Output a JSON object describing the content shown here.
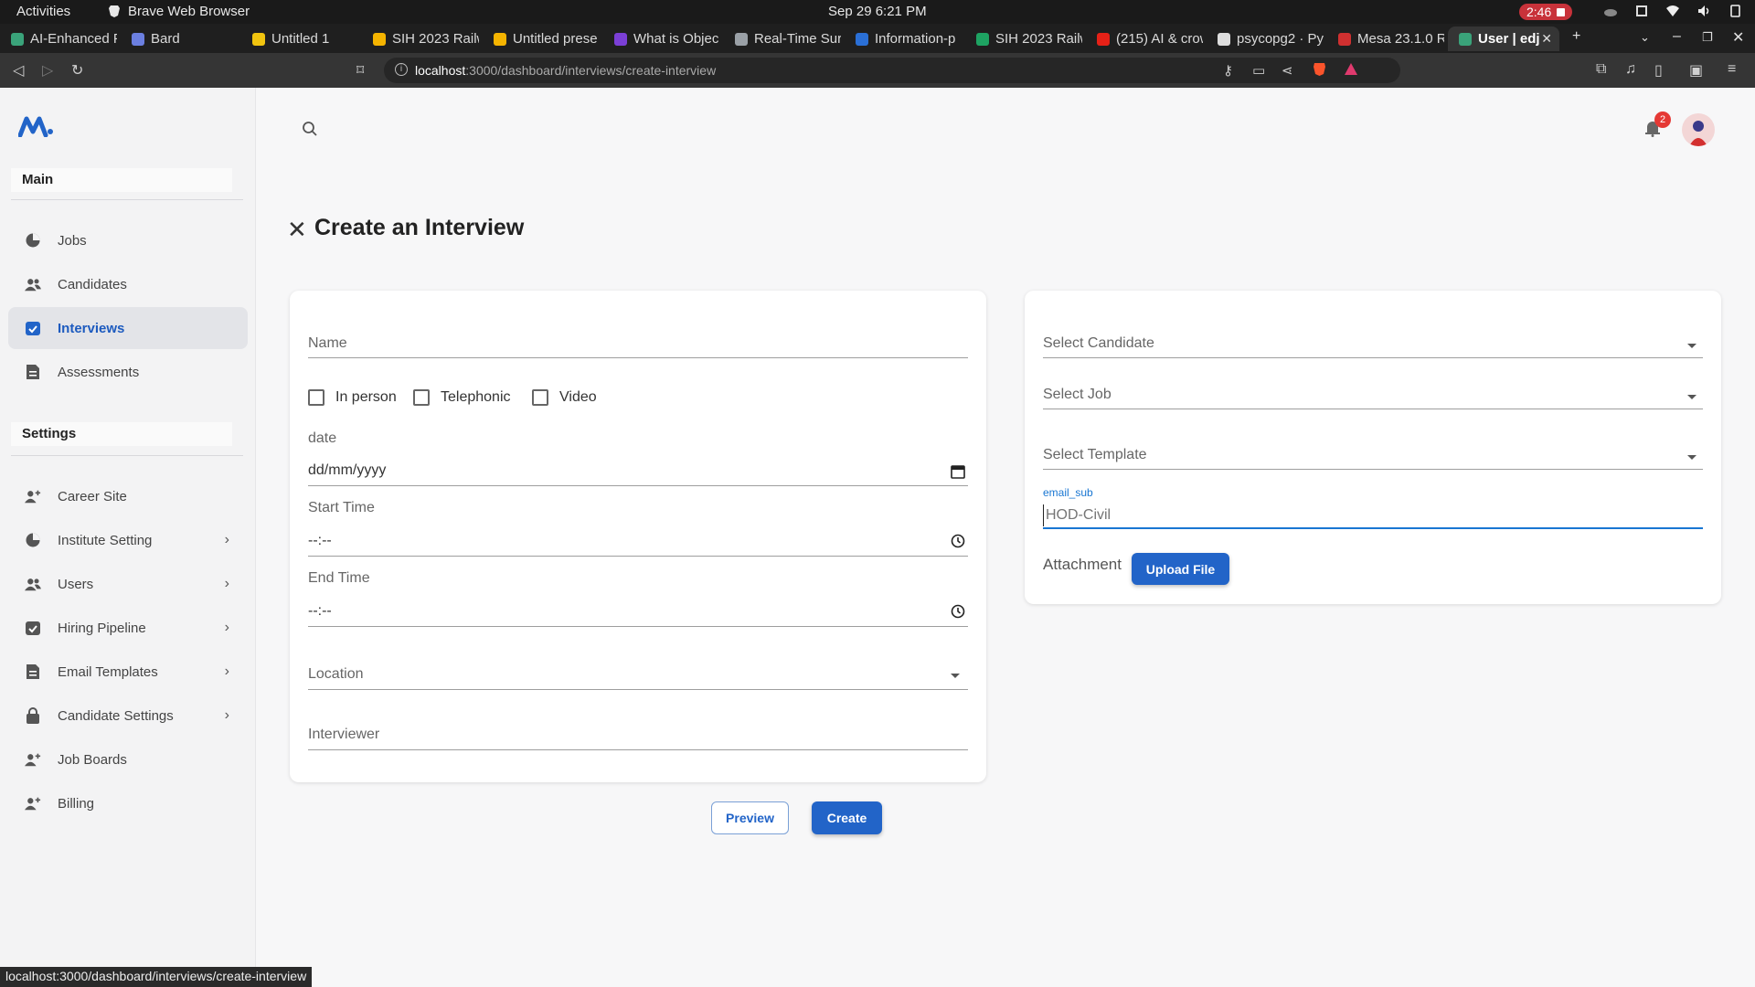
{
  "os_bar": {
    "activities": "Activities",
    "app_name": "Brave Web Browser",
    "clock": "Sep 29  6:21 PM",
    "recording_time": "2:46"
  },
  "browser": {
    "tabs": [
      {
        "title": "AI-Enhanced F",
        "color": "#3aa37a"
      },
      {
        "title": "Bard",
        "color": "#6b7fe0"
      },
      {
        "title": "Untitled 1",
        "color": "#f1c40f"
      },
      {
        "title": "SIH 2023 Railw",
        "color": "#f5b400"
      },
      {
        "title": "Untitled prese",
        "color": "#f5b400"
      },
      {
        "title": "What is Objec",
        "color": "#7b3fd6"
      },
      {
        "title": "Real-Time Sur",
        "color": "#9aa0a6"
      },
      {
        "title": "Information-p",
        "color": "#2a6fd6"
      },
      {
        "title": "SIH 2023 Railw",
        "color": "#1ea362"
      },
      {
        "title": "(215) AI & crow",
        "color": "#e62117"
      },
      {
        "title": "psycopg2 · Py",
        "color": "#dddddd"
      },
      {
        "title": "Mesa 23.1.0 R",
        "color": "#d03030"
      },
      {
        "title": "User | edj",
        "color": "#3aa37a"
      }
    ],
    "url_host": "localhost",
    "url_path": ":3000/dashboard/interviews/create-interview",
    "status_url": "localhost:3000/dashboard/interviews/create-interview"
  },
  "sidebar": {
    "main_title": "Main",
    "main_items": [
      {
        "label": "Jobs",
        "icon": "pie-chart-icon"
      },
      {
        "label": "Candidates",
        "icon": "people-icon"
      },
      {
        "label": "Interviews",
        "icon": "calendar-check-icon",
        "active": true
      },
      {
        "label": "Assessments",
        "icon": "document-icon"
      }
    ],
    "settings_title": "Settings",
    "settings_items": [
      {
        "label": "Career Site",
        "icon": "person-add-icon",
        "chevron": false
      },
      {
        "label": "Institute Setting",
        "icon": "pie-chart-icon",
        "chevron": true
      },
      {
        "label": "Users",
        "icon": "people-icon",
        "chevron": true
      },
      {
        "label": "Hiring Pipeline",
        "icon": "calendar-check-icon",
        "chevron": true
      },
      {
        "label": "Email Templates",
        "icon": "document-icon",
        "chevron": true
      },
      {
        "label": "Candidate Settings",
        "icon": "lock-icon",
        "chevron": true
      },
      {
        "label": "Job Boards",
        "icon": "person-add-icon",
        "chevron": false
      },
      {
        "label": "Billing",
        "icon": "person-add-icon",
        "chevron": false
      }
    ]
  },
  "header": {
    "notification_count": "2"
  },
  "page": {
    "title": "Create an Interview"
  },
  "form_left": {
    "name_placeholder": "Name",
    "modes": [
      "In person",
      "Telephonic",
      "Video"
    ],
    "date_label": "date",
    "date_value": "dd/mm/yyyy",
    "start_label": "Start Time",
    "start_value": "--:--",
    "end_label": "End Time",
    "end_value": "--:--",
    "location_label": "Location",
    "interviewer_label": "Interviewer"
  },
  "form_right": {
    "candidate_label": "Select Candidate",
    "job_label": "Select Job",
    "template_label": "Select Template",
    "email_sub_label": "email_sub",
    "email_sub_placeholder": "HOD-Civil",
    "attachment_label": "Attachment",
    "upload_label": "Upload File"
  },
  "actions": {
    "preview_label": "Preview",
    "create_label": "Create"
  },
  "colors": {
    "accent": "#2264c8",
    "active_nav_text": "#1d5bbf"
  }
}
